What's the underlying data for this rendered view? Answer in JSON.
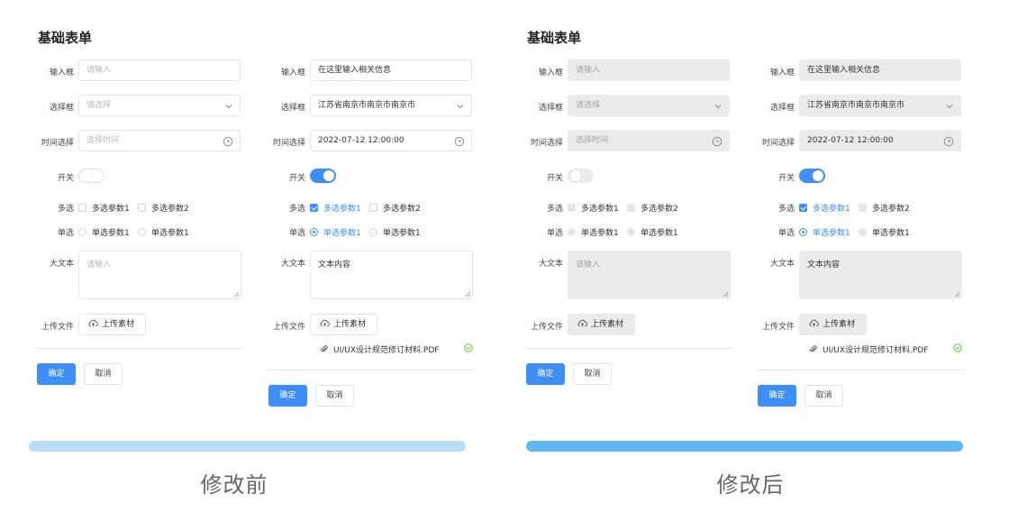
{
  "colors": {
    "primary": "#3e8ef7",
    "bar_before": "#b9ddf5",
    "bar_after": "#5fb8f3",
    "success": "#52c41a"
  },
  "panels": {
    "before": {
      "title": "基础表单",
      "caption": "修改前",
      "disabled_look": false
    },
    "after": {
      "title": "基础表单",
      "caption": "修改后",
      "disabled_look": true
    }
  },
  "form": {
    "labels": {
      "input": "输入框",
      "select": "选择框",
      "time": "时间选择",
      "switch": "开关",
      "checkbox": "多选",
      "radio": "单选",
      "textarea": "大文本",
      "upload": "上传文件"
    },
    "empty": {
      "input_placeholder": "请输入",
      "select_placeholder": "请选择",
      "time_placeholder": "选择时间",
      "textarea_placeholder": "请输入",
      "switch_on": false,
      "checkbox_checked": [
        false,
        false
      ],
      "radio_selected": -1
    },
    "filled": {
      "input_value": "在这里输入相关信息",
      "select_value": "江苏省南京市南京市南京市",
      "time_value": "2022-07-12 12:00:00",
      "textarea_value": "文本内容",
      "switch_on": true,
      "checkbox_checked": [
        true,
        false
      ],
      "radio_selected": 0,
      "file_name": "UI/UX设计规范修订材料.PDF"
    },
    "checkbox_options": [
      "多选参数1",
      "多选参数2"
    ],
    "radio_options": [
      "单选参数1",
      "单选参数1"
    ],
    "upload_button": "上传素材",
    "confirm_button": "确定",
    "cancel_button": "取消"
  },
  "icons": {
    "select": "chevron-down-icon",
    "time": "clock-icon",
    "upload": "cloud-upload-icon",
    "file": "paperclip-icon",
    "file_status": "check-circle-icon",
    "textarea": "resize-handle-icon"
  }
}
